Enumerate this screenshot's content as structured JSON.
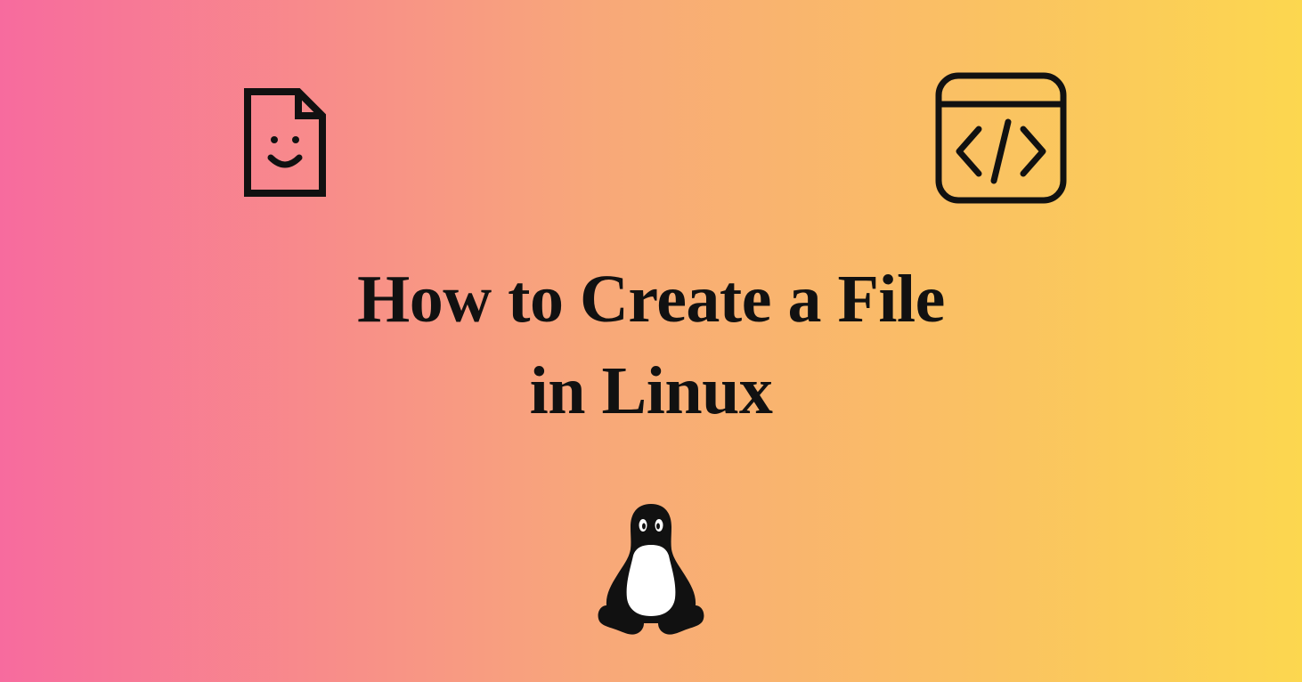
{
  "title_line1": "How to Create a File",
  "title_line2": "in Linux",
  "icons": {
    "file": "file-smile-icon",
    "code": "code-window-icon",
    "linux": "linux-tux-icon"
  }
}
